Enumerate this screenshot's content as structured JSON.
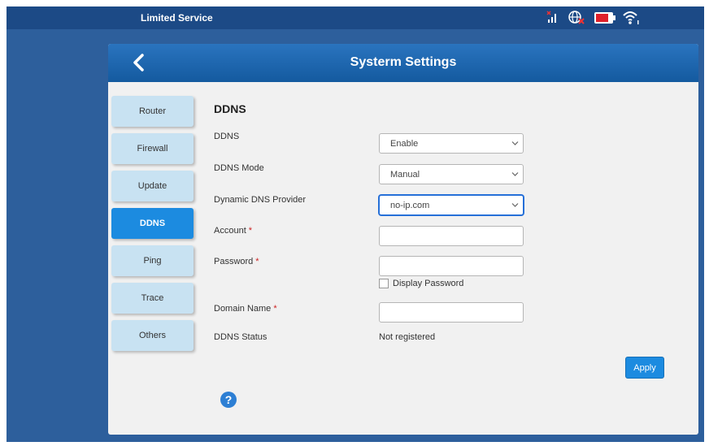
{
  "status_bar": {
    "service_text": "Limited Service",
    "icons": [
      "signal-icon",
      "globe-no-connection-icon",
      "battery-icon",
      "wifi-icon"
    ]
  },
  "header": {
    "title": "Systerm Settings",
    "back_icon": "chevron-left-icon"
  },
  "sidebar": {
    "items": [
      {
        "label": "Router"
      },
      {
        "label": "Firewall"
      },
      {
        "label": "Update"
      },
      {
        "label": "DDNS",
        "active": true
      },
      {
        "label": "Ping"
      },
      {
        "label": "Trace"
      },
      {
        "label": "Others"
      }
    ]
  },
  "form": {
    "section_title": "DDNS",
    "ddns_label": "DDNS",
    "ddns_value": "Enable",
    "mode_label": "DDNS Mode",
    "mode_value": "Manual",
    "provider_label": "Dynamic DNS Provider",
    "provider_value": "no-ip.com",
    "account_label": "Account",
    "account_value": "",
    "password_label": "Password",
    "password_value": "",
    "display_password_label": "Display Password",
    "domain_label": "Domain Name",
    "domain_value": "",
    "status_label": "DDNS Status",
    "status_value": "Not registered",
    "required_mark": "*",
    "apply_label": "Apply"
  },
  "help": {
    "glyph": "?"
  },
  "colors": {
    "accent": "#1c8be0",
    "background": "#2d5f9c",
    "header": "#1a65b0",
    "menu_idle": "#c8e2f2",
    "required": "#cc2222"
  }
}
